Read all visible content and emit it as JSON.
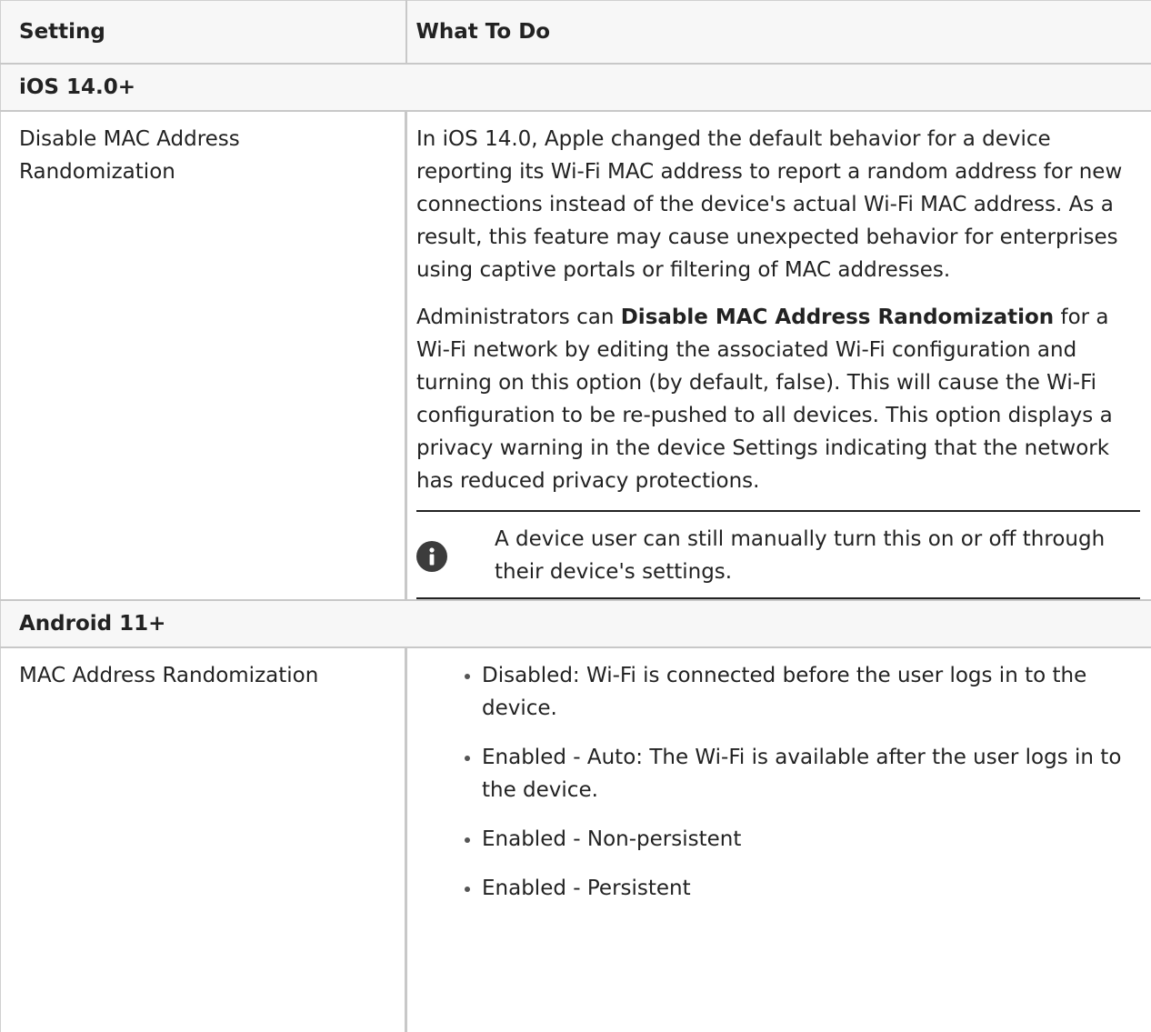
{
  "table": {
    "header": {
      "setting": "Setting",
      "what_to_do": "What To Do"
    },
    "sections": [
      {
        "title": "iOS 14.0+",
        "rows": [
          {
            "setting": "Disable MAC Address Randomization",
            "paragraph1": "In iOS 14.0, Apple changed the default behavior for a device reporting its Wi-Fi MAC address to report a random address for new connections instead of the device's actual Wi-Fi MAC address. As a result, this feature may cause unexpected behavior for enterprises using captive portals or filtering of MAC addresses.",
            "paragraph2_prefix": "Administrators can ",
            "paragraph2_bold": "Disable MAC Address Randomization",
            "paragraph2_suffix": " for a Wi-Fi network by editing the associated Wi-Fi configuration and turning on this option (by default, false). This will cause the Wi-Fi configuration to be re-pushed to all devices. This option displays a privacy warning in the device Settings indicating that the network has reduced privacy protections.",
            "note_icon": "info-icon",
            "note_text": "A device user can still manually turn this on or off through their device's settings."
          }
        ]
      },
      {
        "title": "Android 11+",
        "rows": [
          {
            "setting": "MAC Address Randomization",
            "bullets": [
              "Disabled: Wi-Fi is connected before the user logs in to the device.",
              "Enabled - Auto: The Wi-Fi is available after the user logs in to the device.",
              "Enabled - Non-persistent",
              "Enabled - Persistent"
            ]
          }
        ]
      }
    ]
  },
  "colors": {
    "header_bg": "#f7f7f7",
    "border": "#c8c8c8",
    "text": "#222222",
    "note_icon_bg": "#3c3c3c"
  }
}
